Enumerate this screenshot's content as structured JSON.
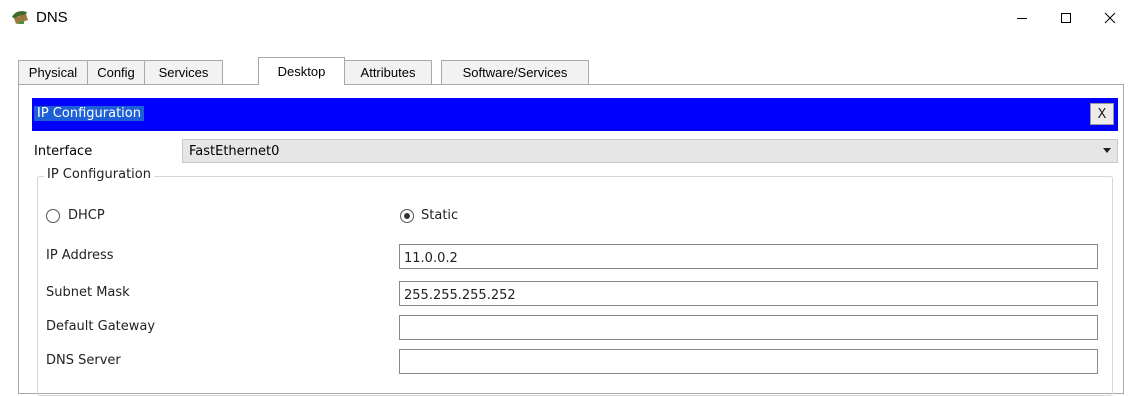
{
  "window": {
    "title": "DNS",
    "icon": "router-device-icon",
    "controls": {
      "minimize": "minimize-icon",
      "maximize": "maximize-icon",
      "close": "close-icon"
    }
  },
  "tabs": [
    {
      "label": "Physical",
      "active": false
    },
    {
      "label": "Config",
      "active": false
    },
    {
      "label": "Services",
      "active": false
    },
    {
      "label": "Desktop",
      "active": true
    },
    {
      "label": "Attributes",
      "active": false
    },
    {
      "label": "Software/Services",
      "active": false
    }
  ],
  "ip_config": {
    "header_title": "IP Configuration",
    "header_close": "X",
    "header_color": "#0000ff",
    "interface_label": "Interface",
    "interface_value": "FastEthernet0",
    "group_legend": "IP Configuration",
    "dhcp_label": "DHCP",
    "static_label": "Static",
    "mode_selected": "Static",
    "fields": {
      "ip_address": {
        "label": "IP Address",
        "value": "11.0.0.2"
      },
      "subnet_mask": {
        "label": "Subnet Mask",
        "value": "255.255.255.252"
      },
      "default_gateway": {
        "label": "Default Gateway",
        "value": ""
      },
      "dns_server": {
        "label": "DNS Server",
        "value": ""
      }
    }
  }
}
